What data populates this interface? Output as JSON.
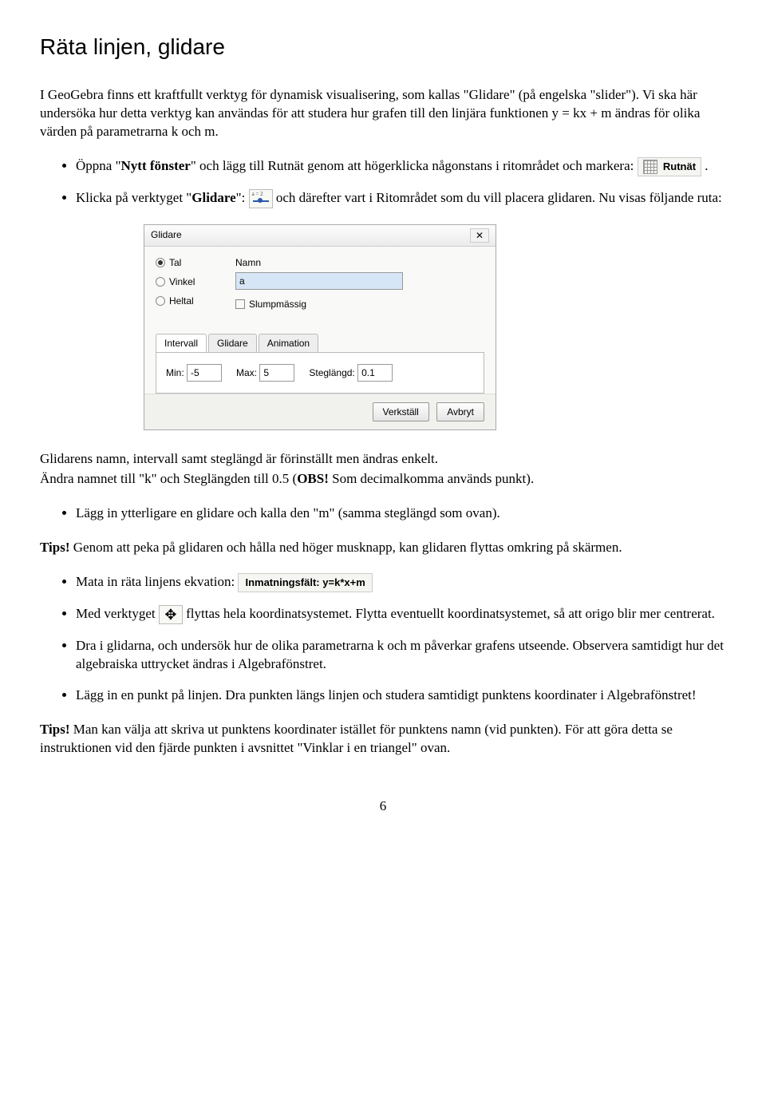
{
  "title": "Räta linjen, glidare",
  "intro1": "I GeoGebra  finns ett kraftfullt verktyg för dynamisk visualisering, som kallas \"Glidare\" (på engelska \"slider\"). Vi ska här undersöka hur detta verktyg kan användas för att studera hur grafen till den linjära funktionen y = kx + m ändras för olika värden på parametrarna k och m.",
  "b1_pre": "Öppna \"",
  "b1_bold1": "Nytt fönster",
  "b1_post": "\" och lägg till Rutnät genom att högerklicka någonstans i ritområdet och markera: ",
  "rutnat_label": "Rutnät",
  "b2_pre": "Klicka på verktyget \"",
  "b2_bold": "Glidare",
  "b2_mid": "\": ",
  "b2_post": " och därefter vart i Ritområdet som du vill placera glidaren. Nu visas följande ruta:",
  "dialog": {
    "title": "Glidare",
    "radios": {
      "tal": "Tal",
      "vinkel": "Vinkel",
      "heltal": "Heltal"
    },
    "namn_label": "Namn",
    "namn_value": "a",
    "random_label": "Slumpmässig",
    "tabs": {
      "intervall": "Intervall",
      "glidare": "Glidare",
      "animation": "Animation"
    },
    "min_label": "Min:",
    "min_value": "-5",
    "max_label": "Max:",
    "max_value": "5",
    "step_label": "Steglängd:",
    "step_value": "0.1",
    "apply": "Verkställ",
    "cancel": "Avbryt"
  },
  "p_after_dlg1": "Glidarens namn, intervall samt steglängd är förinställt men ändras enkelt.",
  "p_after_dlg2_pre": "Ändra namnet till \"k\" och Steglängden till 0.5 (",
  "p_after_dlg2_bold": "OBS!",
  "p_after_dlg2_post": " Som decimalkomma används punkt).",
  "b3": "Lägg in ytterligare en glidare och kalla den \"m\" (samma steglängd som ovan).",
  "tips1_bold": "Tips!",
  "tips1": "  Genom att peka på glidaren och hålla ned höger musknapp, kan glidaren flyttas omkring på skärmen.",
  "b4": "Mata in räta linjens ekvation:  ",
  "inputfield_label": "Inmatningsfält:",
  "inputfield_value": "y=k*x+m",
  "b5_pre": "Med verktyget ",
  "b5_post": "  flyttas hela koordinatsystemet. Flytta eventuellt koordinatsystemet, så att origo blir mer centrerat.",
  "b6": "Dra i glidarna, och undersök hur de olika parametrarna k och m påverkar grafens utseende. Observera samtidigt hur det algebraiska uttrycket ändras i Algebrafönstret.",
  "b7": "Lägg in en punkt på linjen. Dra punkten längs linjen och studera samtidigt punktens koordinater i Algebrafönstret!",
  "tips2_bold": "Tips!",
  "tips2": "  Man kan välja att skriva ut punktens koordinater istället för punktens namn (vid punkten). För att göra detta se instruktionen vid den fjärde punkten i avsnittet \"Vinklar i en triangel\" ovan.",
  "page": "6"
}
